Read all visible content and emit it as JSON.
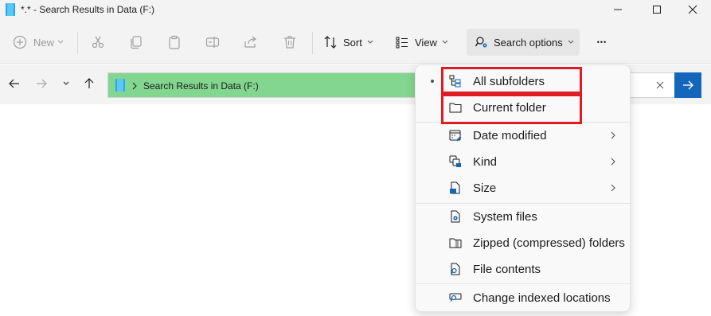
{
  "window": {
    "title": "*.* - Search Results in Data (F:)"
  },
  "toolbar": {
    "new_label": "New",
    "sort_label": "Sort",
    "view_label": "View",
    "search_options_label": "Search options",
    "more_glyph": "•••"
  },
  "address": {
    "path_label": "Search Results in Data (F:)",
    "highlight_color": "#83d68f"
  },
  "menu": {
    "location_items": [
      {
        "label": "All subfolders",
        "icon": "subfolders-icon",
        "selected": true
      },
      {
        "label": "Current folder",
        "icon": "folder-icon",
        "selected": false
      }
    ],
    "filter_items": [
      {
        "label": "Date modified",
        "icon": "calendar-edit-icon",
        "has_submenu": true
      },
      {
        "label": "Kind",
        "icon": "kind-icon",
        "has_submenu": true
      },
      {
        "label": "Size",
        "icon": "size-icon",
        "has_submenu": true
      }
    ],
    "advanced_items": [
      {
        "label": "System files",
        "icon": "system-file-icon"
      },
      {
        "label": "Zipped (compressed) folders",
        "icon": "zip-folder-icon"
      },
      {
        "label": "File contents",
        "icon": "file-search-icon"
      }
    ],
    "footer_item": {
      "label": "Change indexed locations",
      "icon": "indexed-locations-icon"
    }
  },
  "colors": {
    "accent_blue": "#1366b9",
    "annotation_red": "#e01b24"
  }
}
